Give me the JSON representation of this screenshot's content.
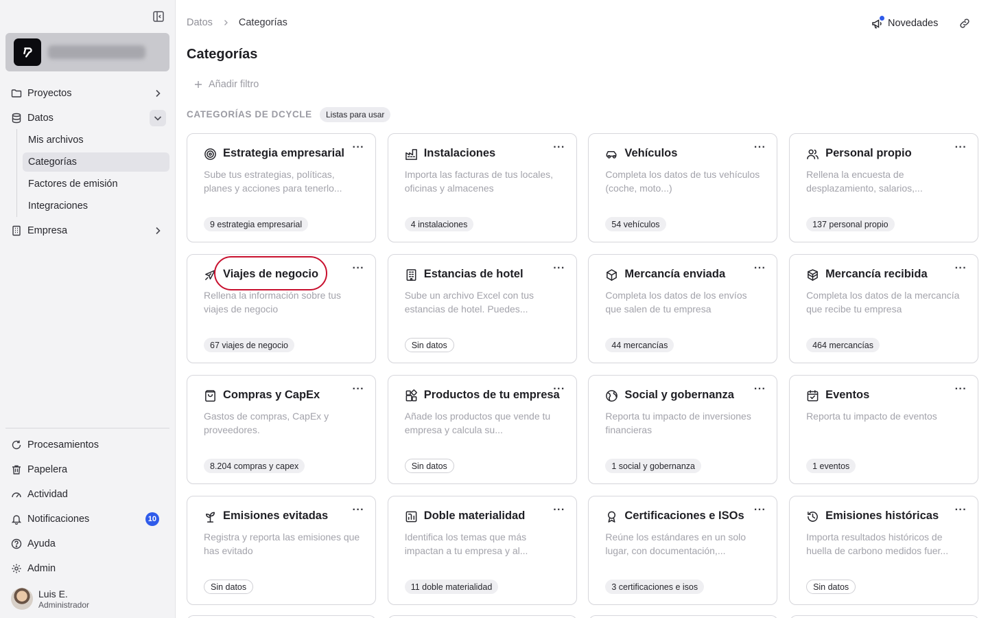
{
  "sidebar": {
    "nav": [
      {
        "label": "Proyectos",
        "icon": "folder-icon",
        "chevron": "chevron-right-icon"
      },
      {
        "label": "Datos",
        "icon": "database-icon",
        "chevron": "chevron-down-icon"
      },
      {
        "label": "Empresa",
        "icon": "building-icon",
        "chevron": "chevron-right-icon"
      }
    ],
    "sub_items": [
      "Mis archivos",
      "Categorías",
      "Factores de emisión",
      "Integraciones"
    ],
    "active_sub": "Categorías",
    "bottom": [
      {
        "label": "Procesamientos",
        "icon": "refresh-icon"
      },
      {
        "label": "Papelera",
        "icon": "trash-icon"
      },
      {
        "label": "Actividad",
        "icon": "gauge-icon"
      },
      {
        "label": "Notificaciones",
        "icon": "bell-icon",
        "badge": "10"
      },
      {
        "label": "Ayuda",
        "icon": "help-icon"
      },
      {
        "label": "Admin",
        "icon": "gear-icon"
      }
    ],
    "user": {
      "name": "Luis E.",
      "role": "Administrador"
    }
  },
  "header": {
    "breadcrumb": {
      "parent": "Datos",
      "current": "Categorías"
    },
    "novedades_label": "Novedades"
  },
  "main": {
    "title": "Categorías",
    "add_filter_label": "Añadir filtro",
    "section_title": "CATEGORÍAS DE DCYCLE",
    "section_tag": "Listas para usar",
    "cards": [
      {
        "title": "Estrategia empresarial",
        "icon": "target-icon",
        "desc": "Sube tus estrategias, políticas, planes y acciones para tenerlo...",
        "count": "9 estrategia empresarial",
        "empty": false
      },
      {
        "title": "Instalaciones",
        "icon": "factory-icon",
        "desc": "Importa las facturas de tus locales, oficinas y almacenes",
        "count": "4 instalaciones",
        "empty": false
      },
      {
        "title": "Vehículos",
        "icon": "car-icon",
        "desc": "Completa los datos de tus vehículos (coche, moto...)",
        "count": "54 vehículos",
        "empty": false
      },
      {
        "title": "Personal propio",
        "icon": "users-icon",
        "desc": "Rellena la encuesta de desplazamiento, salarios,...",
        "count": "137 personal propio",
        "empty": false
      },
      {
        "title": "Viajes de negocio",
        "icon": "plane-icon",
        "desc": "Rellena la información sobre tus viajes de negocio",
        "count": "67 viajes de negocio",
        "empty": false,
        "highlighted": true
      },
      {
        "title": "Estancias de hotel",
        "icon": "hotel-icon",
        "desc": "Sube un archivo Excel con tus estancias de hotel. Puedes...",
        "count": "Sin datos",
        "empty": true
      },
      {
        "title": "Mercancía enviada",
        "icon": "package-icon",
        "desc": "Completa los datos de los envíos que salen de tu empresa",
        "count": "44 mercancías",
        "empty": false
      },
      {
        "title": "Mercancía recibida",
        "icon": "package-open-icon",
        "desc": "Completa los datos de la mercancía que recibe tu empresa",
        "count": "464 mercancías",
        "empty": false
      },
      {
        "title": "Compras y CapEx",
        "icon": "shopping-bag-icon",
        "desc": "Gastos de compras, CapEx y proveedores.",
        "count": "8.204 compras y capex",
        "empty": false
      },
      {
        "title": "Productos de tu empresa",
        "icon": "blocks-icon",
        "desc": "Añade los productos que vende tu empresa y calcula su...",
        "count": "Sin datos",
        "empty": true
      },
      {
        "title": "Social y gobernanza",
        "icon": "globe-icon",
        "desc": "Reporta tu impacto de inversiones financieras",
        "count": "1 social y gobernanza",
        "empty": false
      },
      {
        "title": "Eventos",
        "icon": "calendar-icon",
        "desc": "Reporta tu impacto de eventos",
        "count": "1 eventos",
        "empty": false
      },
      {
        "title": "Emisiones evitadas",
        "icon": "sprout-icon",
        "desc": "Registra y reporta las emisiones que has evitado",
        "count": "Sin datos",
        "empty": true
      },
      {
        "title": "Doble materialidad",
        "icon": "chart-icon",
        "desc": "Identifica los temas que más impactan a tu empresa y al...",
        "count": "11 doble materialidad",
        "empty": false
      },
      {
        "title": "Certificaciones e ISOs",
        "icon": "award-icon",
        "desc": "Reúne los estándares en un solo lugar, con documentación,...",
        "count": "3 certificaciones e isos",
        "empty": false
      },
      {
        "title": "Emisiones históricas",
        "icon": "history-icon",
        "desc": "Importa resultados históricos de huella de carbono medidos fuer...",
        "count": "Sin datos",
        "empty": true
      }
    ]
  }
}
